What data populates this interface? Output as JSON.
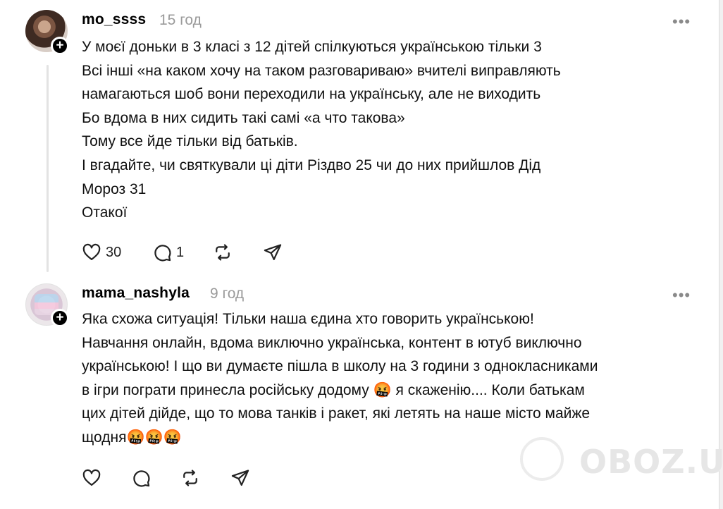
{
  "posts": [
    {
      "username": "mo_ssss",
      "time": "15 год",
      "more_icon": "more-icon",
      "text": "У моєї доньки в 3 класі з 12 дітей спілкуються українською тільки 3\nВсі інші «на каком хочу на таком разговариваю» вчителі виправляють\nнамагаються шоб вони переходили на українську, але не виходить\nБо вдома в них сидить такі самі «а что такова»\nТому все йде тільки від батьків.\nІ вгадайте, чи святкували ці діти Різдво 25 чи до них прийшлов Дід\nМороз 31\nОтакої",
      "likes": "30",
      "replies": "1"
    },
    {
      "username": "mama_nashyla",
      "time": "9 год",
      "more_icon": "more-icon",
      "text": "Яка схожа ситуація! Тільки наша єдина хто говорить українською!\nНавчання онлайн, вдома виключно українська, контент в ютуб виключно\nукраїнською! І що ви думаєте пішла в школу на 3 години з однокласниками\nв ігри пограти принесла російську додому 🤬 я скаженію.... Коли батькам\nцих дітей дійде, що то мова танків і ракет, які летять на наше місто майже\nщодня🤬🤬🤬",
      "likes": "",
      "replies": ""
    }
  ],
  "watermark": {
    "text": "OBOZ.UA"
  },
  "colors": {
    "muted": "#9a9a9a",
    "text": "#111111",
    "thread_line": "#e3e3e3"
  }
}
